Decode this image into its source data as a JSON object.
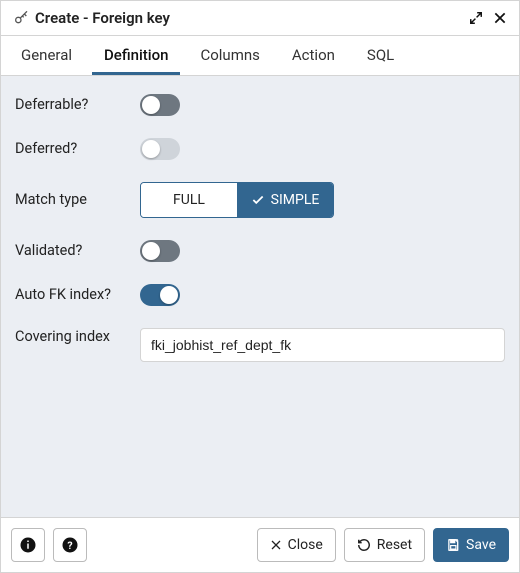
{
  "header": {
    "title": "Create - Foreign key"
  },
  "tabs": [
    {
      "label": "General",
      "active": false
    },
    {
      "label": "Definition",
      "active": true
    },
    {
      "label": "Columns",
      "active": false
    },
    {
      "label": "Action",
      "active": false
    },
    {
      "label": "SQL",
      "active": false
    }
  ],
  "form": {
    "deferrable_label": "Deferrable?",
    "deferrable_on": false,
    "deferred_label": "Deferred?",
    "deferred_on": false,
    "deferred_disabled": true,
    "match_label": "Match type",
    "match_options": {
      "full": "FULL",
      "simple": "SIMPLE"
    },
    "match_selected": "simple",
    "validated_label": "Validated?",
    "validated_on": false,
    "autofk_label": "Auto FK index?",
    "autofk_on": true,
    "covering_label": "Covering index",
    "covering_value": "fki_jobhist_ref_dept_fk"
  },
  "footer": {
    "close": "Close",
    "reset": "Reset",
    "save": "Save"
  }
}
